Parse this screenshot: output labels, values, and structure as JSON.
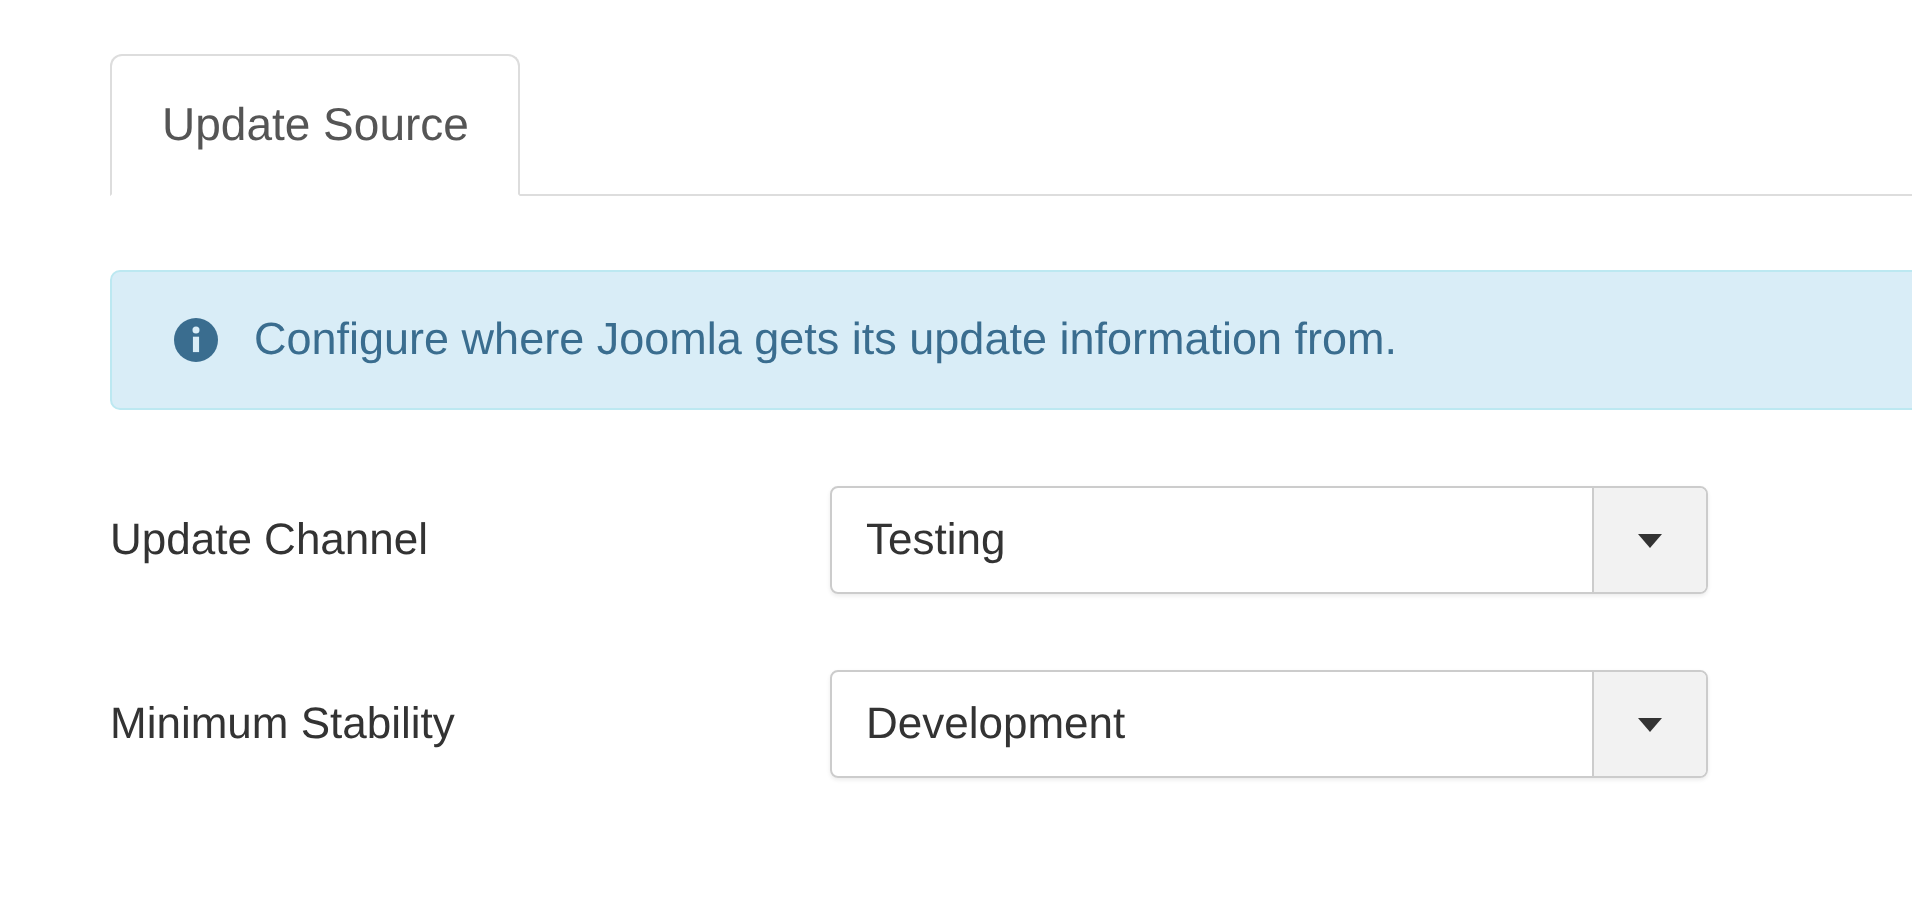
{
  "tabs": [
    {
      "label": "Update Source",
      "selected": true
    }
  ],
  "alert": {
    "kind": "info",
    "text": "Configure where Joomla gets its update information from."
  },
  "fields": [
    {
      "label": "Update Channel",
      "value": "Testing"
    },
    {
      "label": "Minimum Stability",
      "value": "Development"
    }
  ]
}
